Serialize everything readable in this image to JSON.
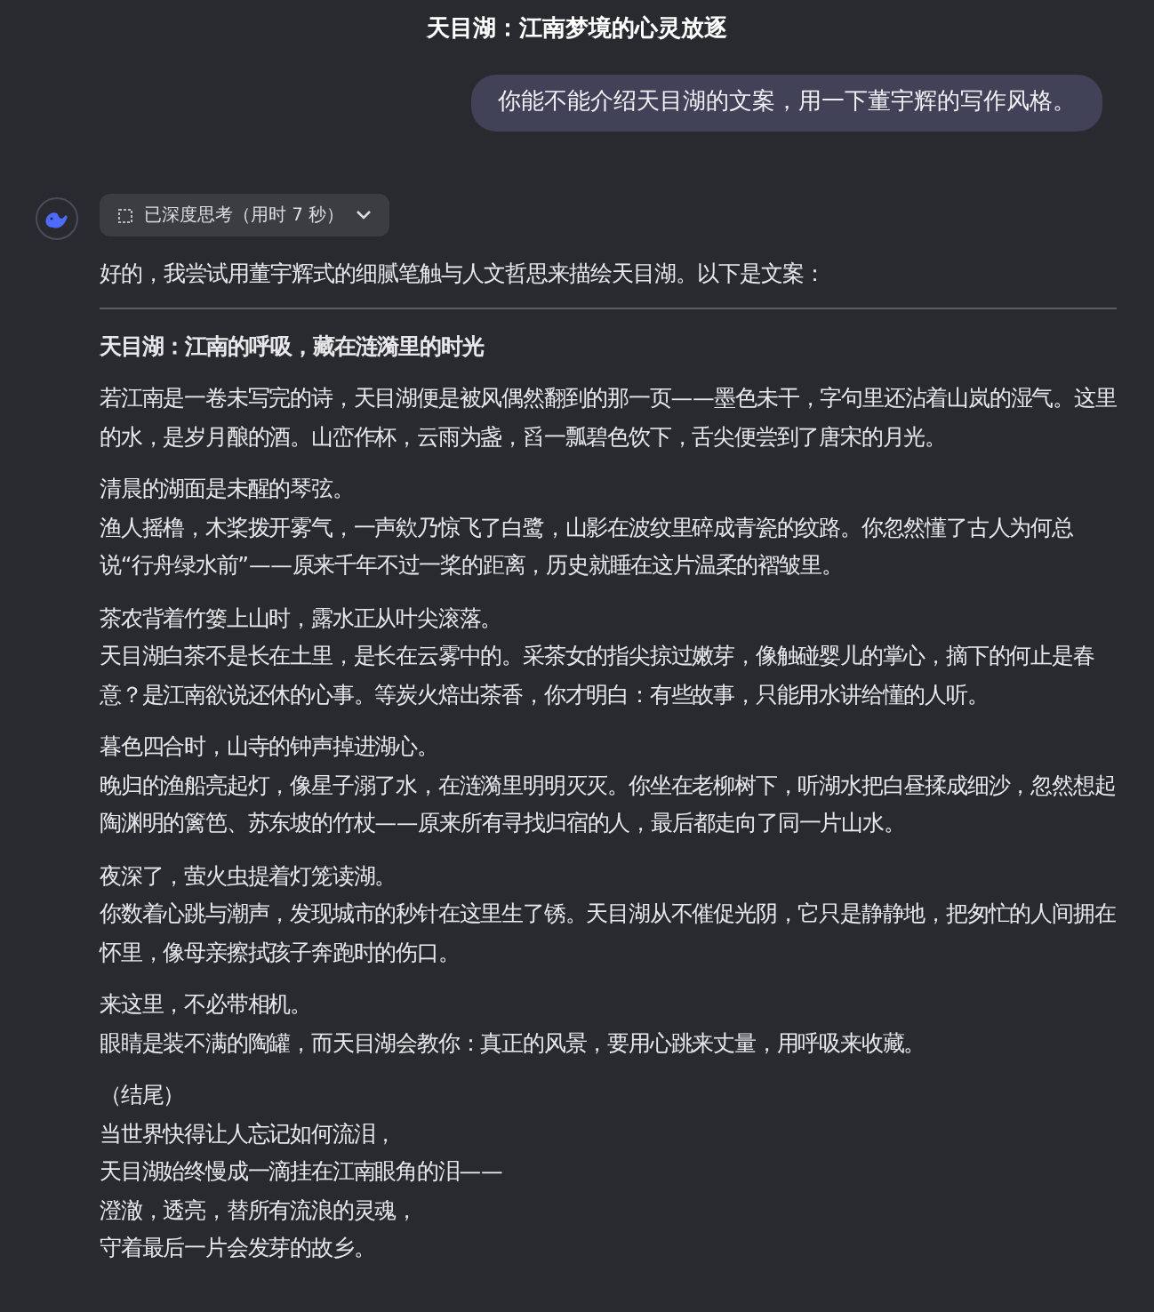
{
  "chat_title": "天目湖：江南梦境的心灵放逐",
  "user_message": "你能不能介绍天目湖的文案，用一下董宇辉的写作风格。",
  "thinking": {
    "label": "已深度思考（用时 7 秒）",
    "expanded": false
  },
  "reply_intro": "好的，我尝试用董宇辉式的细腻笔触与人文哲思来描绘天目湖。以下是文案：",
  "article_title": "天目湖：江南的呼吸，藏在涟漪里的时光",
  "paragraphs": [
    {
      "lines": [
        "若江南是一卷未写完的诗，天目湖便是被风偶然翻到的那一页——墨色未干，字句里还沾着山岚的湿气。这里的水，是岁月酿的酒。山峦作杯，云雨为盏，舀一瓢碧色饮下，舌尖便尝到了唐宋的月光。"
      ]
    },
    {
      "lines": [
        "清晨的湖面是未醒的琴弦。",
        "渔人摇橹，木桨拨开雾气，一声欸乃惊飞了白鹭，山影在波纹里碎成青瓷的纹路。你忽然懂了古人为何总说“行舟绿水前”——原来千年不过一桨的距离，历史就睡在这片温柔的褶皱里。"
      ]
    },
    {
      "lines": [
        "茶农背着竹篓上山时，露水正从叶尖滚落。",
        "天目湖白茶不是长在土里，是长在云雾中的。采茶女的指尖掠过嫩芽，像触碰婴儿的掌心，摘下的何止是春意？是江南欲说还休的心事。等炭火焙出茶香，你才明白：有些故事，只能用水讲给懂的人听。"
      ]
    },
    {
      "lines": [
        "暮色四合时，山寺的钟声掉进湖心。",
        "晚归的渔船亮起灯，像星子溺了水，在涟漪里明明灭灭。你坐在老柳树下，听湖水把白昼揉成细沙，忽然想起陶渊明的篱笆、苏东坡的竹杖——原来所有寻找归宿的人，最后都走向了同一片山水。"
      ]
    },
    {
      "lines": [
        "夜深了，萤火虫提着灯笼读湖。",
        "你数着心跳与潮声，发现城市的秒针在这里生了锈。天目湖从不催促光阴，它只是静静地，把匆忙的人间拥在怀里，像母亲擦拭孩子奔跑时的伤口。"
      ]
    },
    {
      "lines": [
        "来这里，不必带相机。",
        "眼睛是装不满的陶罐，而天目湖会教你：真正的风景，要用心跳来丈量，用呼吸来收藏。"
      ]
    },
    {
      "lines": [
        "（结尾）",
        "当世界快得让人忘记如何流泪，",
        "天目湖始终慢成一滴挂在江南眼角的泪——",
        "澄澈，透亮，替所有流浪的灵魂，",
        "守着最后一片会发芽的故乡。"
      ]
    }
  ]
}
